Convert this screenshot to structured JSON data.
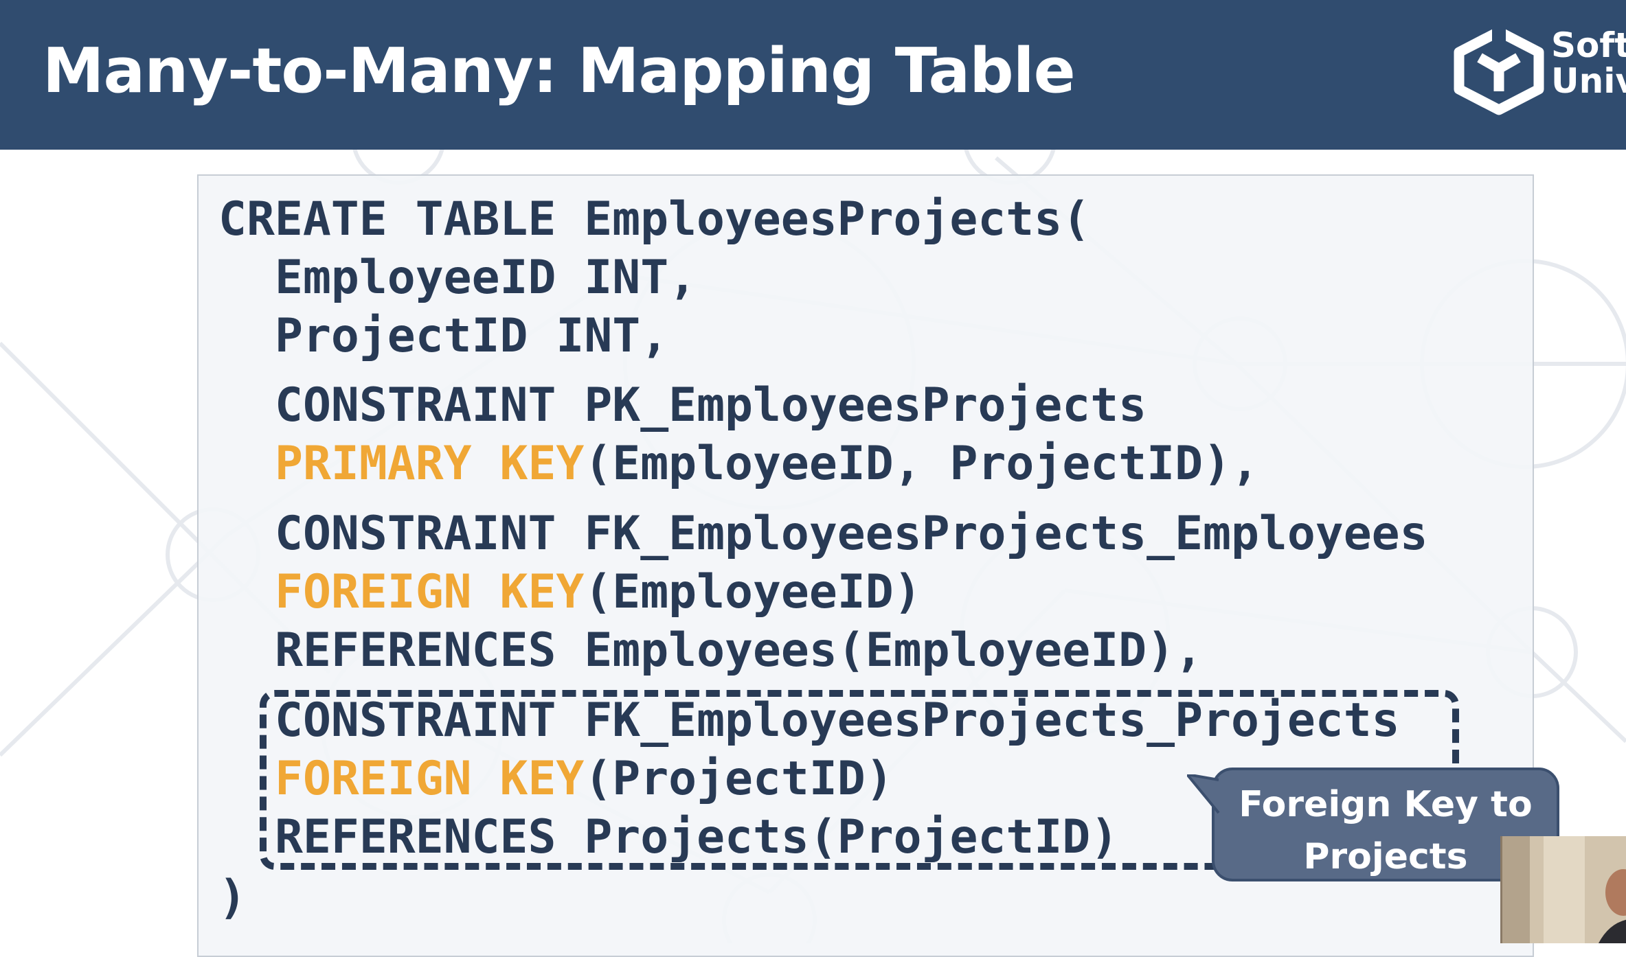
{
  "slide": {
    "title": "Many-to-Many: Mapping Table",
    "logo": {
      "icon": "softuni-cube-icon",
      "line1": "Softw",
      "line2": "Univ"
    }
  },
  "code": {
    "lines": [
      [
        {
          "text": "CREATE TABLE EmployeesProjects("
        }
      ],
      [
        {
          "text": "EmployeeID INT,"
        }
      ],
      [
        {
          "text": "ProjectID INT,"
        }
      ],
      [
        {
          "text": "CONSTRAINT PK_EmployeesProjects"
        }
      ],
      [
        {
          "text": "PRIMARY KEY",
          "highlight": true
        },
        {
          "text": "(EmployeeID, ProjectID),"
        }
      ],
      [
        {
          "text": "CONSTRAINT FK_EmployeesProjects_Employees"
        }
      ],
      [
        {
          "text": "FOREIGN KEY",
          "highlight": true
        },
        {
          "text": "(EmployeeID)"
        }
      ],
      [
        {
          "text": "REFERENCES Employees(EmployeeID),"
        }
      ],
      [
        {
          "text": "CONSTRAINT FK_EmployeesProjects_Projects"
        }
      ],
      [
        {
          "text": "FOREIGN KEY",
          "highlight": true
        },
        {
          "text": "(ProjectID)"
        }
      ],
      [
        {
          "text": "REFERENCES Projects(ProjectID)"
        }
      ],
      [
        {
          "text": ")"
        }
      ]
    ]
  },
  "callout": {
    "line1": "Foreign Key to",
    "line2": "Projects"
  },
  "colors": {
    "header": "#304c6f",
    "code_text": "#283a55",
    "keyword": "#f0a735",
    "callout": "#586a87"
  },
  "webcam": {
    "icon": "presenter-video-thumbnail"
  }
}
